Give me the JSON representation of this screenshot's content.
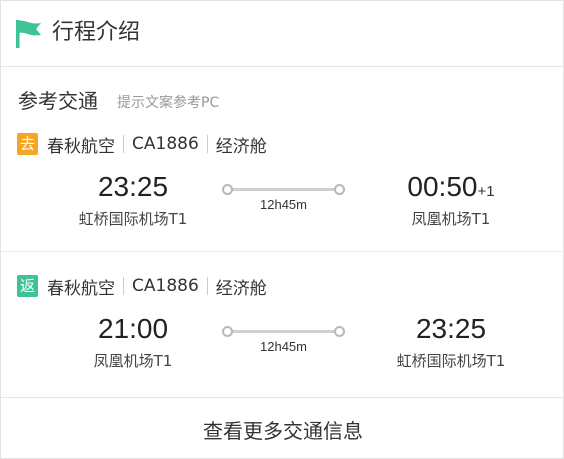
{
  "header": {
    "icon": "flag-icon",
    "icon_color": "#3ec494",
    "title": "行程介绍"
  },
  "section": {
    "title": "参考交通",
    "hint": "提示文案参考PC"
  },
  "flights": [
    {
      "badge": "去",
      "badge_color": "#f5a623",
      "airline": "春秋航空",
      "flight_no": "CA1886",
      "cabin": "经济舱",
      "dep_time": "23:25",
      "dep_airport": "虹桥国际机场T1",
      "arr_time": "00:50",
      "arr_day": "+1",
      "arr_airport": "凤凰机场T1",
      "duration": "12h45m"
    },
    {
      "badge": "返",
      "badge_color": "#3ec494",
      "airline": "春秋航空",
      "flight_no": "CA1886",
      "cabin": "经济舱",
      "dep_time": "21:00",
      "dep_airport": "凤凰机场T1",
      "arr_time": "23:25",
      "arr_airport": "虹桥国际机场T1",
      "duration": "12h45m"
    }
  ],
  "more_button": {
    "label": "查看更多交通信息"
  }
}
